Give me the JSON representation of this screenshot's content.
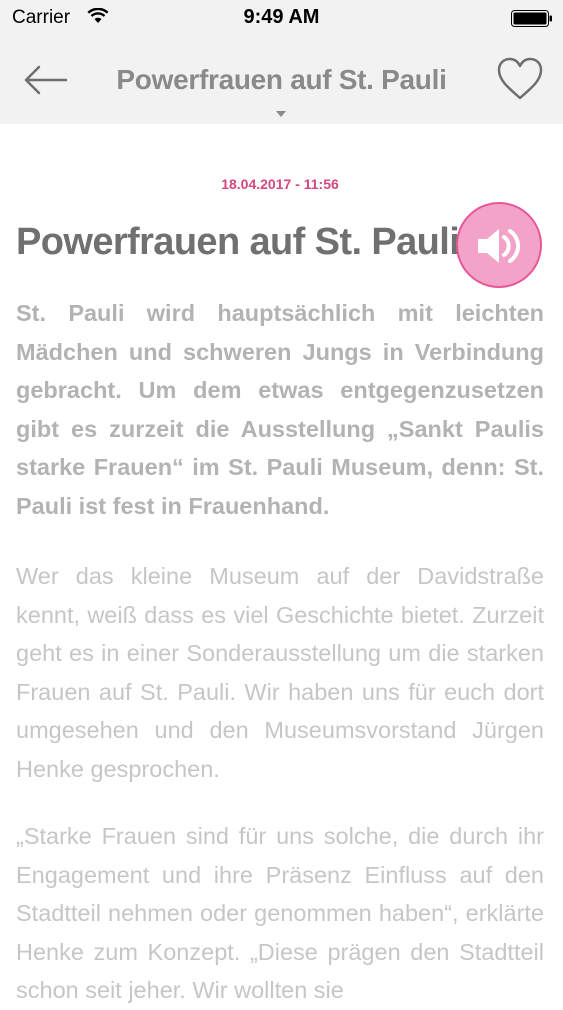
{
  "status_bar": {
    "carrier": "Carrier",
    "time": "9:49 AM"
  },
  "nav": {
    "title": "Powerfrauen auf St. Pauli"
  },
  "article": {
    "date": "18.04.2017 - 11:56",
    "headline": "Powerfrauen auf St. Pauli",
    "lead": "St. Pauli wird hauptsächlich mit leichten Mädchen und schweren Jungs in Verbindung gebracht. Um dem etwas entgegenzusetzen gibt es zurzeit die Ausstellung „Sankt Paulis starke Frauen“ im St. Pauli Museum, denn: St. Pauli ist fest in Frauenhand.",
    "paragraph_2": "Wer das kleine Museum auf der Davidstraße kennt, weiß dass es viel Geschichte bietet. Zurzeit geht es in einer Sonderausstellung um die starken Frauen auf St. Pauli. Wir haben uns für euch dort umgesehen und den Museumsvorstand Jürgen Henke gesprochen.",
    "paragraph_3": "„Starke Frauen sind für uns solche, die durch ihr Engagement und ihre Präsenz Einfluss auf den Stadtteil nehmen oder genommen haben“, erklärte Henke zum Konzept. „Diese prägen den Stadtteil schon seit jeher. Wir wollten sie"
  },
  "icons": {
    "back": "back-arrow-icon",
    "favorite": "heart-outline-icon",
    "audio": "speaker-icon",
    "title_dropdown": "chevron-down-icon"
  },
  "colors": {
    "accent": "#d6477f",
    "audio_fill": "#f3a3c8",
    "bar_bg": "#f2f2f2",
    "headline": "#707070",
    "body_text": "#c6c6c6"
  }
}
